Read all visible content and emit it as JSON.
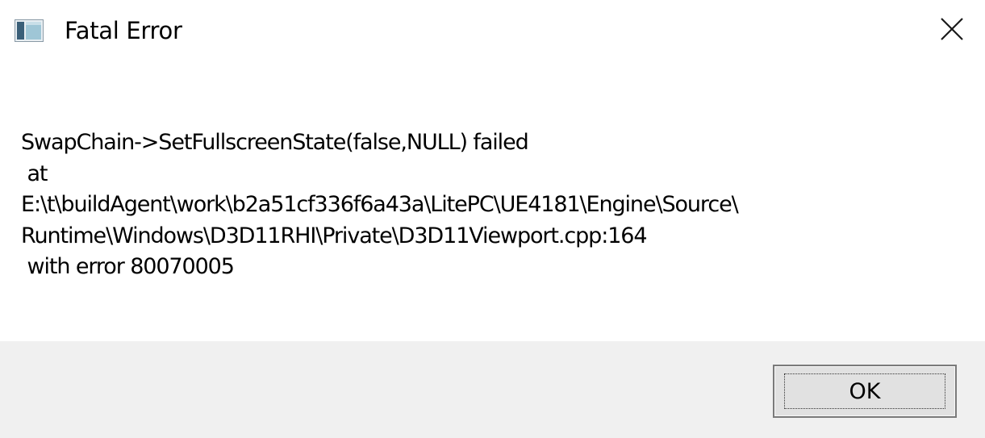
{
  "window": {
    "title": "Fatal Error",
    "icon": "application-window-icon",
    "close_icon": "close-icon"
  },
  "message": {
    "lines": [
      "SwapChain->SetFullscreenState(false,NULL) failed",
      " at",
      "E:\\t\\buildAgent\\work\\b2a51cf336f6a43a\\LitePC\\UE4181\\Engine\\Source\\",
      "Runtime\\Windows\\D3D11RHI\\Private\\D3D11Viewport.cpp:164",
      " with error 80070005"
    ]
  },
  "footer": {
    "ok_label": "OK"
  },
  "colors": {
    "window_background": "#ffffff",
    "footer_background": "#f0f0f0",
    "button_background": "#e1e1e1",
    "button_border": "#7a7a7a"
  }
}
